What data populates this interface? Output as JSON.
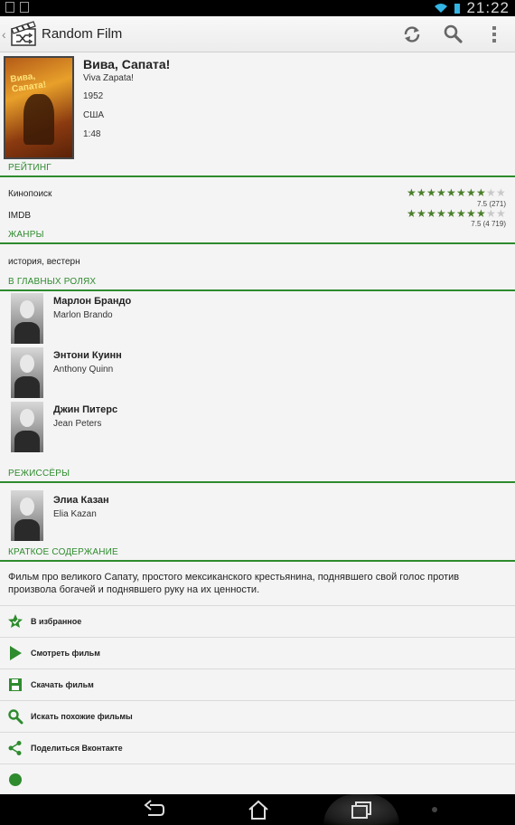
{
  "status": {
    "time": "21:22"
  },
  "appbar": {
    "title": "Random Film",
    "icons": [
      "refresh-icon",
      "search-icon",
      "overflow-menu-icon"
    ]
  },
  "movie": {
    "title": "Вива, Сапата!",
    "original_title": "Viva Zapata!",
    "year": "1952",
    "country": "США",
    "duration": "1:48",
    "poster_text": "Вива, Сапата!"
  },
  "sections": {
    "rating": "РЕЙТИНГ",
    "genres": "ЖАНРЫ",
    "cast": "В ГЛАВНЫХ РОЛЯХ",
    "directors": "РЕЖИССЁРЫ",
    "summary": "КРАТКОЕ СОДЕРЖАНИЕ"
  },
  "ratings": [
    {
      "source": "Кинопоиск",
      "value": 7.5,
      "max": 10,
      "summary": "7.5 (271)"
    },
    {
      "source": "IMDB",
      "value": 7.5,
      "max": 10,
      "summary": "7.5 (4 719)"
    }
  ],
  "genres": "история, вестерн",
  "cast": [
    {
      "name": "Марлон Брандо",
      "original": "Marlon Brando"
    },
    {
      "name": "Энтони Куинн",
      "original": "Anthony Quinn"
    },
    {
      "name": "Джин Питерс",
      "original": "Jean Peters"
    }
  ],
  "directors": [
    {
      "name": "Элиа Казан",
      "original": "Elia Kazan"
    }
  ],
  "summary": "Фильм про великого Сапату, простого мексиканского крестьянина, поднявшего свой голос против произвола богачей и поднявшего руку на их ценности.",
  "actions": [
    {
      "label": "В избранное",
      "icon": "favorite-star-icon"
    },
    {
      "label": "Смотреть фильм",
      "icon": "play-icon"
    },
    {
      "label": "Скачать фильм",
      "icon": "save-icon"
    },
    {
      "label": "Искать похожие фильмы",
      "icon": "search-icon"
    },
    {
      "label": "Поделиться Вконтакте",
      "icon": "share-icon"
    }
  ],
  "colors": {
    "accent": "#2e8b2e",
    "star_fill": "#4a7f2a",
    "star_empty": "#c9c9c9"
  }
}
